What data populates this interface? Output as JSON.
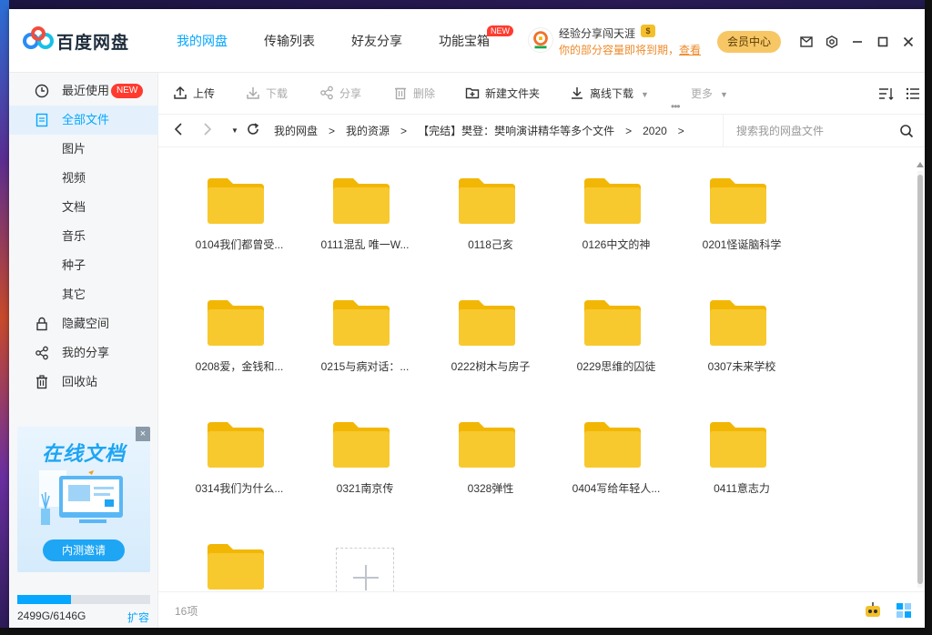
{
  "app": {
    "brand": "百度网盘",
    "nav": [
      {
        "label": "我的网盘",
        "active": true
      },
      {
        "label": "传输列表"
      },
      {
        "label": "好友分享"
      },
      {
        "label": "功能宝箱",
        "badge": "NEW"
      }
    ],
    "promo": {
      "name": "经验分享闯天涯",
      "message": "你的部分容量即将到期，",
      "link": "查看"
    },
    "vip_label": "会员中心"
  },
  "sidebar": {
    "items": [
      {
        "label": "最近使用",
        "icon": "clock-icon",
        "badge": "NEW"
      },
      {
        "label": "全部文件",
        "icon": "document-icon",
        "active": true
      },
      {
        "label": "图片"
      },
      {
        "label": "视频"
      },
      {
        "label": "文档"
      },
      {
        "label": "音乐"
      },
      {
        "label": "种子"
      },
      {
        "label": "其它"
      },
      {
        "label": "隐藏空间",
        "icon": "lock-icon"
      },
      {
        "label": "我的分享",
        "icon": "share-icon"
      },
      {
        "label": "回收站",
        "icon": "trash-icon"
      }
    ],
    "ad": {
      "title": "在线文档",
      "button": "内测邀请",
      "close": "×"
    },
    "quota": {
      "text": "2499G/6146G",
      "link": "扩容",
      "fraction": 0.4066
    }
  },
  "toolbar": {
    "upload": "上传",
    "download": "下载",
    "share": "分享",
    "delete": "删除",
    "new_folder": "新建文件夹",
    "offline": "离线下载",
    "more": "更多"
  },
  "address": {
    "crumbs": [
      "我的网盘",
      "我的资源",
      "【完结】樊登：樊响演讲精华等多个文件",
      "2020"
    ],
    "separator": ">",
    "search_placeholder": "搜索我的网盘文件"
  },
  "files": [
    "0104我们都曾受...",
    "0111混乱 唯一W...",
    "0118己亥",
    "0126中文的神",
    "0201怪诞脑科学",
    "0208爱，金钱和...",
    "0215与病对话：...",
    "0222树木与房子",
    "0229思维的囚徒",
    "0307未来学校",
    "0314我们为什么...",
    "0321南京传",
    "0328弹性",
    "0404写给年轻人...",
    "0411意志力",
    ""
  ],
  "status": {
    "count": "16项"
  },
  "colors": {
    "accent": "#06a7ff",
    "folder": "#f8c92e",
    "folder_tab": "#f2b705",
    "new_badge": "#ff3b2f",
    "vip": "#f7c766"
  }
}
